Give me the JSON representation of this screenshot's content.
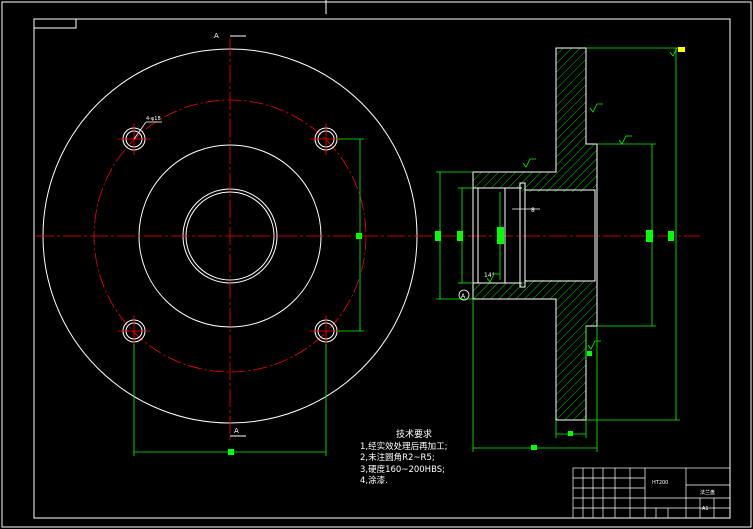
{
  "drawing": {
    "colors": {
      "background": "#000000",
      "outline": "#ffffff",
      "centerline": "#ff0000",
      "dimension": "#00ff00",
      "hatch": "#00cc00"
    },
    "section_marks": {
      "top": "A",
      "bottom": "A"
    },
    "hole_callout": "4-φ18",
    "annotations": {
      "bore_note": "8",
      "angle_note": "14°",
      "datum": "A"
    }
  },
  "tech_requirements": {
    "title": "技术要求",
    "items": [
      "1,经实效处理后再加工;",
      "2,未注圆角R2~R5;",
      "3,硬度160~200HBS;",
      "4,涂漆."
    ]
  },
  "title_block": {
    "material": "HT200",
    "part_name": "法兰盘",
    "sheet": "A1"
  }
}
